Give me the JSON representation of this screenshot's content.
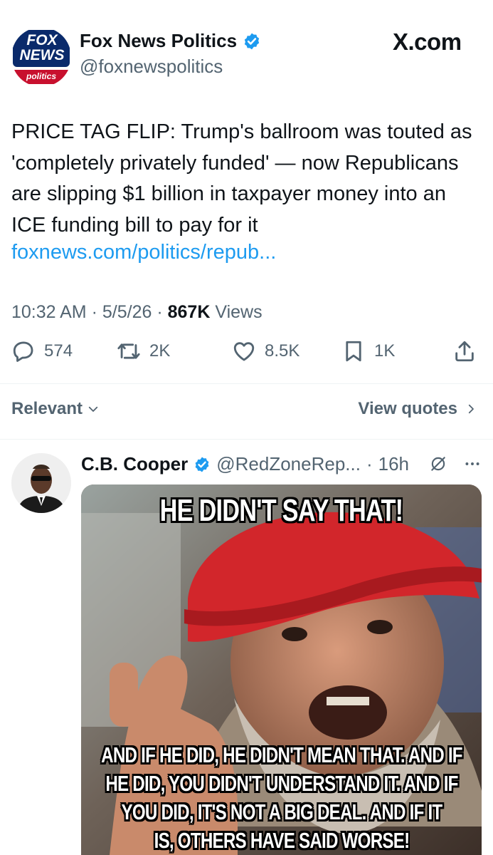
{
  "account": {
    "logo_text_top": "FOX",
    "logo_text_bottom": "NEWS",
    "logo_tag": "politics",
    "name": "Fox News Politics",
    "handle": "@foxnewspolitics",
    "verified": true
  },
  "site": {
    "brand": "X.com"
  },
  "tweet": {
    "text": "PRICE TAG FLIP: Trump's ballroom was touted as 'completely privately funded' — now Republicans are slipping $1 billion in taxpayer money into an ICE funding bill to pay for it",
    "link": "foxnews.com/politics/repub...",
    "time": "10:32 AM",
    "date": "5/5/26",
    "views_count": "867K",
    "views_label": "Views"
  },
  "actions": {
    "replies": "574",
    "reposts": "2K",
    "likes": "8.5K",
    "bookmarks": "1K"
  },
  "sort": {
    "left_label": "Relevant",
    "right_label": "View quotes"
  },
  "reply": {
    "name": "C.B. Cooper",
    "handle": "@RedZoneRep...",
    "separator": "·",
    "time": "16h",
    "meme_top": "HE DIDN'T SAY THAT!",
    "meme_bottom_1": "AND IF HE DID, HE DIDN'T MEAN THAT. AND IF",
    "meme_bottom_2": "HE DID, YOU DIDN'T UNDERSTAND IT. AND IF",
    "meme_bottom_3": "YOU DID, IT'S NOT A BIG DEAL. AND IF IT",
    "meme_bottom_4": "IS, OTHERS HAVE SAID WORSE!"
  },
  "colors": {
    "accent_blue": "#1d9bf0",
    "text_primary": "#0f1419",
    "text_secondary": "#536471",
    "fox_blue": "#0a2a6b",
    "fox_red": "#c8102e"
  }
}
